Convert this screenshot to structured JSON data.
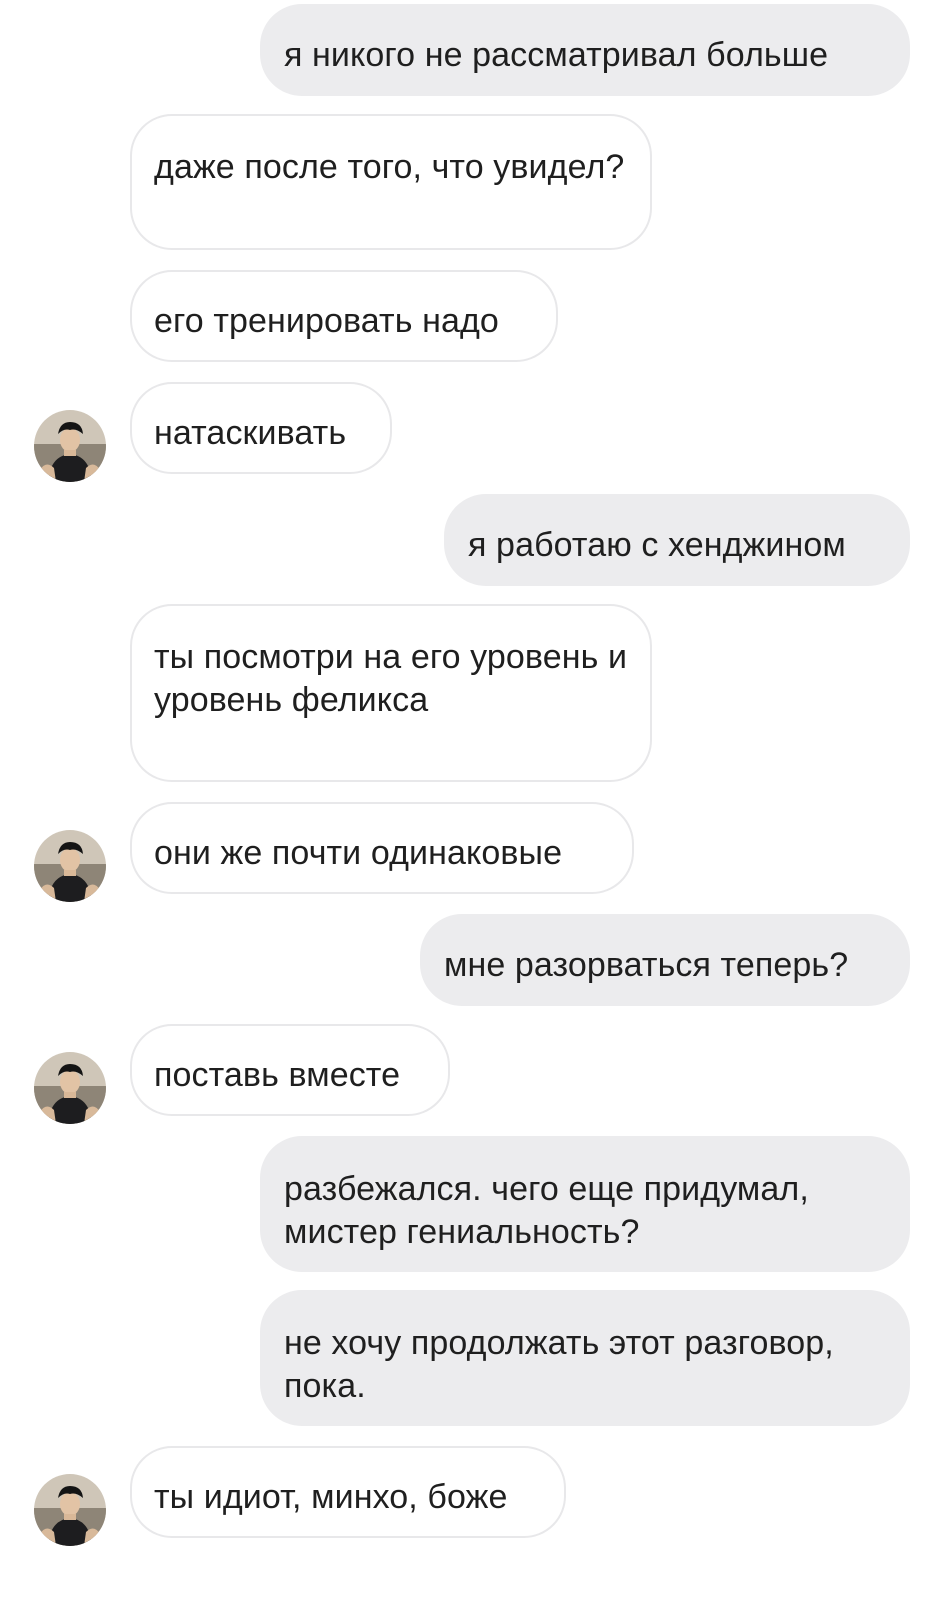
{
  "messages": [
    {
      "side": "out",
      "text": "я никого не рассматривал больше"
    },
    {
      "side": "in",
      "text": "даже после того, что увидел?"
    },
    {
      "side": "in",
      "text": "его тренировать надо"
    },
    {
      "side": "in",
      "text": "натаскивать",
      "avatar": true
    },
    {
      "side": "out",
      "text": "я работаю с хенджином"
    },
    {
      "side": "in",
      "text": "ты посмотри на его уровень и уровень феликса"
    },
    {
      "side": "in",
      "text": "они же почти одинаковые",
      "avatar": true
    },
    {
      "side": "out",
      "text": "мне разорваться теперь?"
    },
    {
      "side": "in",
      "text": "поставь вместе",
      "avatar": true
    },
    {
      "side": "out",
      "text": "разбежался. чего еще придумал, мистер гениальность?"
    },
    {
      "side": "out",
      "text": "не хочу продолжать этот разговор, пока."
    },
    {
      "side": "in",
      "text": "ты идиот, минхо, боже",
      "avatar": true
    }
  ],
  "colors": {
    "incoming_bubble": "#ffffff",
    "incoming_border": "#e8e8ea",
    "outgoing_bubble": "#ececee",
    "text": "#1f1f1f",
    "background": "#ffffff"
  }
}
